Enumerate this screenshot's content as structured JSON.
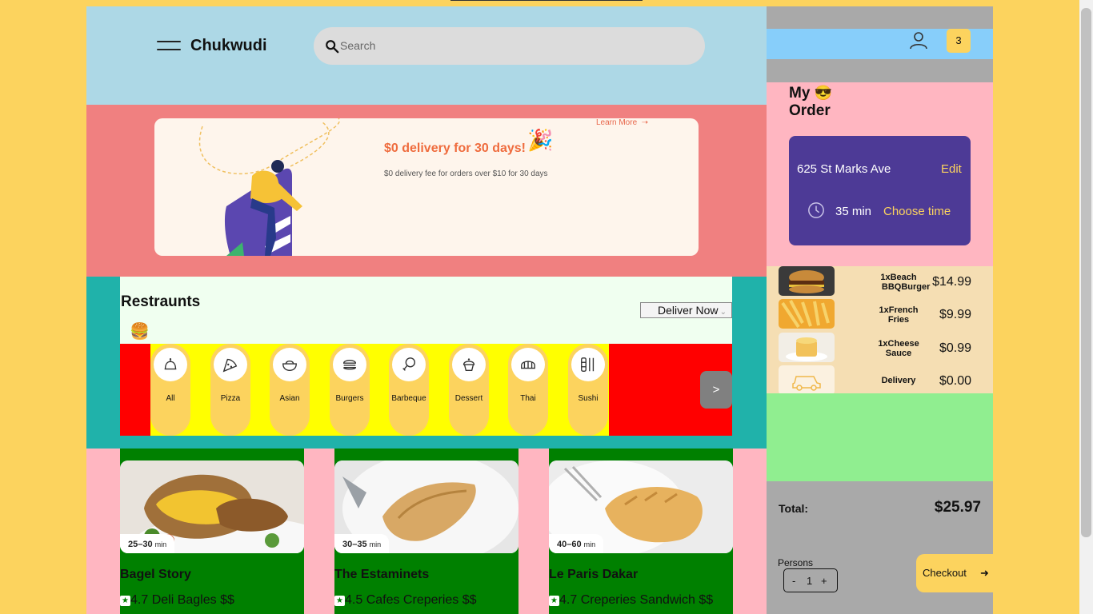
{
  "header": {
    "brand": "Chukwudi",
    "search_placeholder": "Search"
  },
  "promo": {
    "learn_more": "Learn More",
    "title": "$0 delivery for 30 days!",
    "party_emoji": "🎉",
    "subtitle": "$0 delivery fee for orders over $10 for 30 days",
    "accent": "#ef6c3e"
  },
  "restaurants": {
    "title": "Restraunts",
    "emoji": "🍔",
    "deliver_select": "Deliver Now",
    "next_label": ">",
    "categories": [
      {
        "label": "All",
        "icon": "bell-icon"
      },
      {
        "label": "Pizza",
        "icon": "pizza-icon"
      },
      {
        "label": "Asian",
        "icon": "bowl-icon"
      },
      {
        "label": "Burgers",
        "icon": "burger-icon"
      },
      {
        "label": "Barbeque",
        "icon": "drumstick-icon"
      },
      {
        "label": "Dessert",
        "icon": "cupcake-icon"
      },
      {
        "label": "Thai",
        "icon": "dumpling-icon"
      },
      {
        "label": "Sushi",
        "icon": "sushi-icon"
      }
    ]
  },
  "cards": [
    {
      "time": "25–30",
      "unit": "min",
      "name": "Bagel Story",
      "star": "★",
      "meta": "4.7 Deli Bagles $$"
    },
    {
      "time": "30–35",
      "unit": "min",
      "name": "The Estaminets",
      "star": "★",
      "meta": "4.5 Cafes Creperies $$"
    },
    {
      "time": "40–60",
      "unit": "min",
      "name": "Le Paris Dakar",
      "star": "★",
      "meta": "4.7 Creperies Sandwich $$"
    }
  ],
  "sidebar": {
    "cart_count": "3",
    "order_title_line1": "My",
    "order_emoji": "😎",
    "order_title_line2": "Order",
    "address": "625 St Marks Ave",
    "edit": "Edit",
    "minutes": "35 min",
    "choose_time": "Choose time",
    "items": [
      {
        "line1": "1xBeach",
        "line2": "BBQBurger",
        "price": "$14.99"
      },
      {
        "line1": "1xFrench",
        "line2": "Fries",
        "price": "$9.99"
      },
      {
        "line1": "1xCheese",
        "line2": "Sauce",
        "price": "$0.99"
      },
      {
        "line1": "Delivery",
        "line2": "",
        "price": "$0.00"
      }
    ],
    "total_label": "Total:",
    "total_value": "$25.97",
    "persons_label": "Persons",
    "minus": "-",
    "persons_value": "1",
    "plus": "+",
    "checkout": "Checkout",
    "checkout_arrow": "➜"
  }
}
